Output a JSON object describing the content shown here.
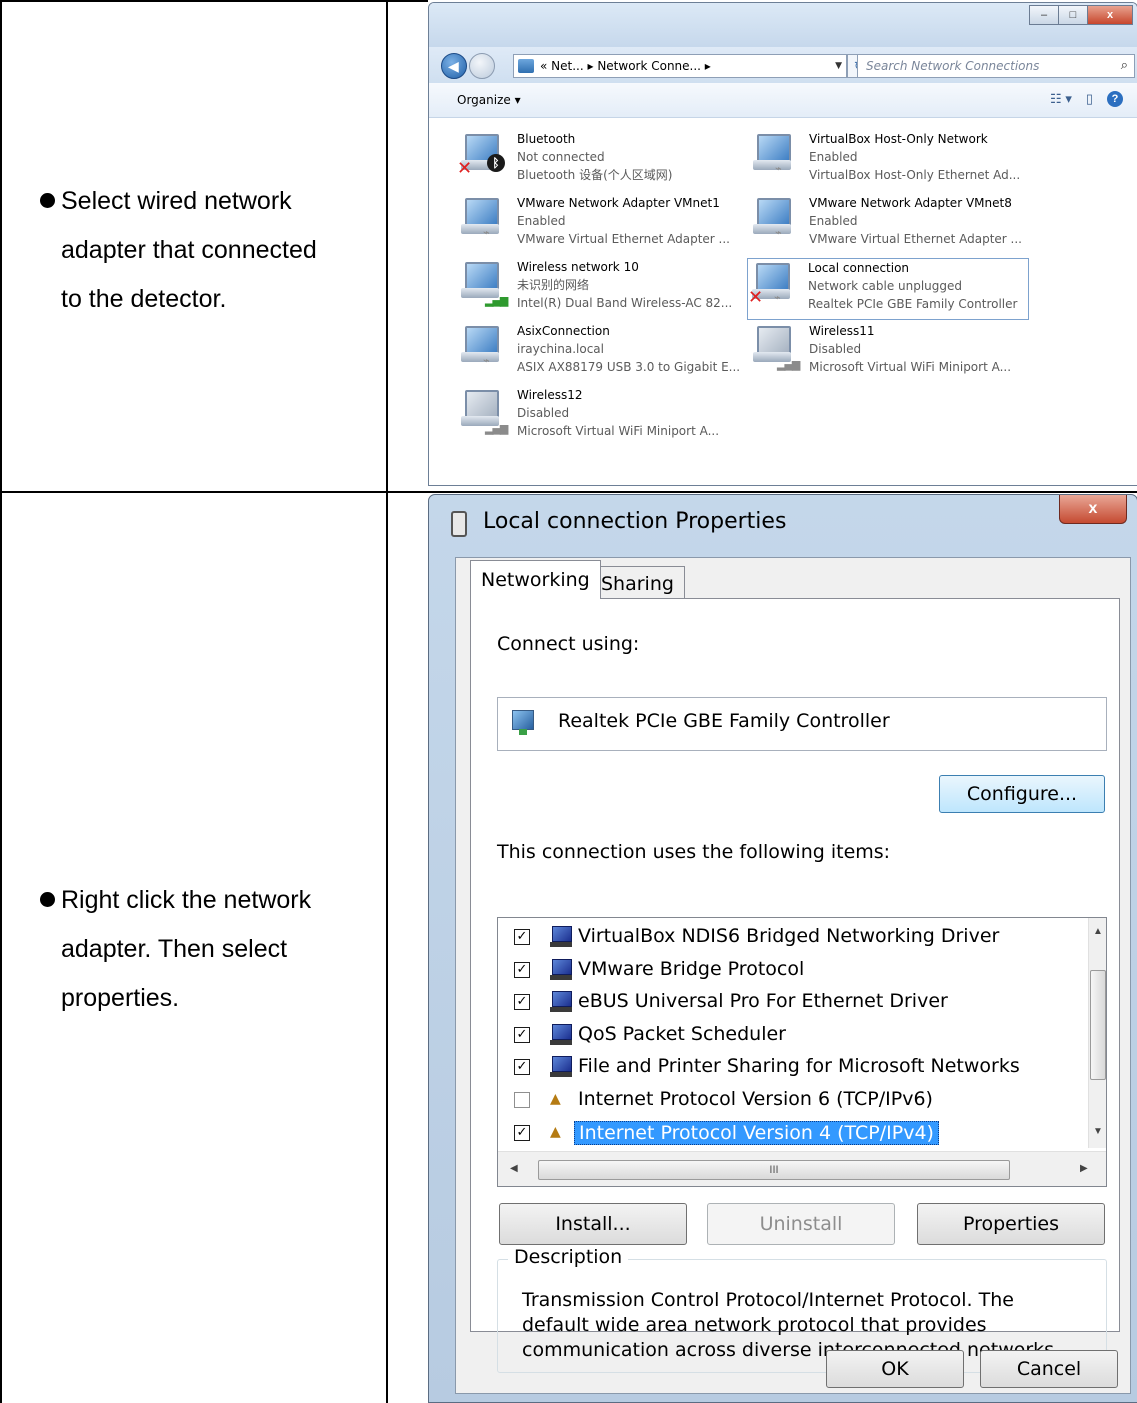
{
  "rows": [
    {
      "bullet": [
        "Select wired network",
        "adapter that connected",
        "to the detector."
      ]
    },
    {
      "bullet": [
        "Right click the network",
        "adapter. Then select",
        "properties."
      ]
    }
  ],
  "explorer": {
    "address": "« Net... ▸ Network Conne... ▸",
    "search_placeholder": "Search Network Connections",
    "organize": "Organize ▾",
    "adapters": [
      {
        "name": "Bluetooth",
        "status": "Not connected",
        "device": "Bluetooth 设备(个人区域网)"
      },
      {
        "name": "VirtualBox Host-Only Network",
        "status": "Enabled",
        "device": "VirtualBox Host-Only Ethernet Ad..."
      },
      {
        "name": "VMware Network Adapter VMnet1",
        "status": "Enabled",
        "device": "VMware Virtual Ethernet Adapter ..."
      },
      {
        "name": "VMware Network Adapter VMnet8",
        "status": "Enabled",
        "device": "VMware Virtual Ethernet Adapter ..."
      },
      {
        "name": "Wireless network 10",
        "status": "未识别的网络",
        "device": "Intel(R) Dual Band Wireless-AC 82..."
      },
      {
        "name": "Local connection",
        "status": "Network cable unplugged",
        "device": "Realtek PCIe GBE Family Controller"
      },
      {
        "name": "AsixConnection",
        "status": "iraychina.local",
        "device": "ASIX AX88179 USB 3.0 to Gigabit E..."
      },
      {
        "name": "Wireless11",
        "status": "Disabled",
        "device": "Microsoft Virtual WiFi Miniport A..."
      },
      {
        "name": "Wireless12",
        "status": "Disabled",
        "device": "Microsoft Virtual WiFi Miniport A..."
      }
    ]
  },
  "dialog": {
    "title": "Local connection Properties",
    "tabs": [
      "Networking",
      "Sharing"
    ],
    "connect_using": "Connect using:",
    "device": "Realtek PCIe GBE Family Controller",
    "configure": "Configure...",
    "items_label": "This connection uses the following items:",
    "items": [
      {
        "label": "VirtualBox NDIS6 Bridged Networking Driver",
        "checked": "☑"
      },
      {
        "label": "VMware Bridge Protocol",
        "checked": "☑"
      },
      {
        "label": "eBUS Universal Pro For Ethernet Driver",
        "checked": "☑"
      },
      {
        "label": "QoS Packet Scheduler",
        "checked": "☑"
      },
      {
        "label": "File and Printer Sharing for Microsoft Networks",
        "checked": "☑"
      },
      {
        "label": "Internet Protocol Version 6 (TCP/IPv6)",
        "checked": ""
      },
      {
        "label": "Internet Protocol Version 4 (TCP/IPv4)",
        "checked": "☑"
      }
    ],
    "install": "Install...",
    "uninstall": "Uninstall",
    "properties": "Properties",
    "description_label": "Description",
    "description": "Transmission Control Protocol/Internet Protocol. The default wide area network protocol that provides communication across diverse interconnected networks.",
    "ok": "OK",
    "cancel": "Cancel",
    "close_glyph": "x",
    "scroll_grip": "III"
  }
}
